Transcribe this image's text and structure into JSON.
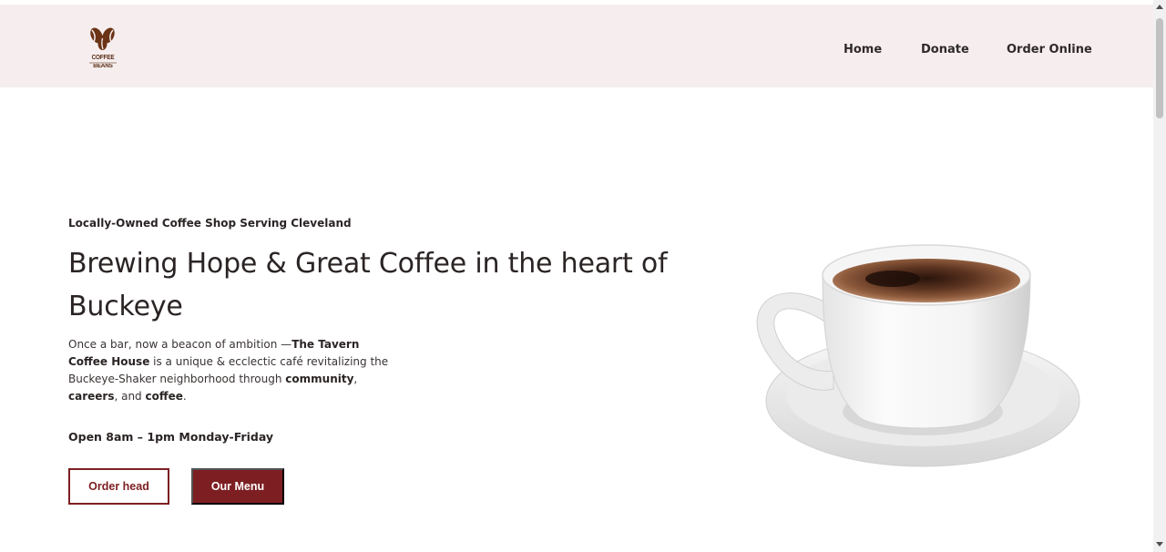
{
  "header": {
    "logo_text": "COFFEE BEANS",
    "nav": [
      {
        "label": "Home"
      },
      {
        "label": "Donate"
      },
      {
        "label": "Order Online"
      }
    ]
  },
  "hero": {
    "eyebrow": "Locally-Owned Coffee Shop Serving Cleveland",
    "headline": "Brewing Hope & Great Coffee in the heart of Buckeye",
    "desc": {
      "p1": "Once a bar, now a beacon of ambition —",
      "b1": "The Tavern Coffee House",
      "p2": " is a unique & ecclectic café revitalizing the Buckeye-Shaker neighborhood through ",
      "b2": "community",
      "p3": ", ",
      "b3": "careers",
      "p4": ", and ",
      "b4": "coffee",
      "p5": "."
    },
    "hours": "Open 8am – 1pm Monday-Friday",
    "buttons": {
      "order": "Order head",
      "menu": "Our Menu"
    }
  },
  "colors": {
    "header_bg": "#f6eeee",
    "accent": "#7d1f22",
    "logo_brown": "#5a2e16"
  },
  "icons": {
    "logo": "coffee-beans-logo",
    "hero_image": "coffee-cup-image"
  }
}
